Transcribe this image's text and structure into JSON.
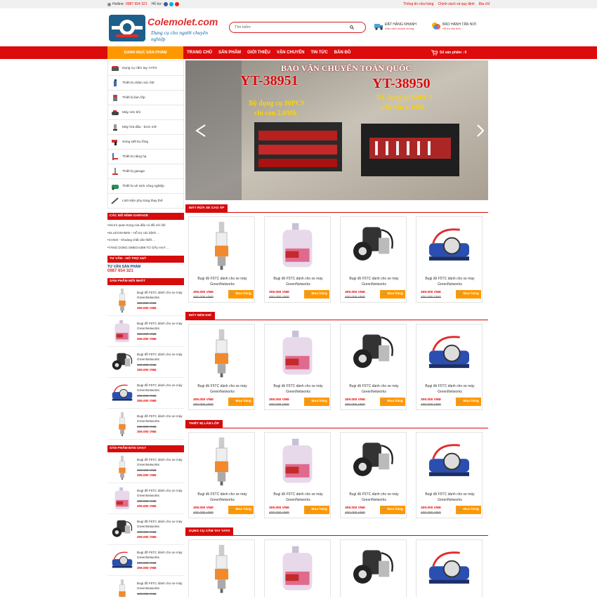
{
  "topbar": {
    "hotline_label": "Hotline:",
    "hotline": "0987 654 321",
    "support_label": "Hỗ trợ:",
    "links": [
      "Thông tin cửa hàng",
      "Chính sách và quy định",
      "Địa chỉ"
    ]
  },
  "logo": {
    "name": "Colemolet.com",
    "tagline": "Dụng cụ cho người chuyên nghiệp"
  },
  "search": {
    "placeholder": "Tìm kiếm"
  },
  "services": [
    {
      "title": "ĐẶT HÀNG NHANH",
      "sub": "Giao dịch nhanh chóng"
    },
    {
      "title": "BẢO HÀNH TẬN NƠI",
      "sub": "Hỗ trợ tận tình"
    }
  ],
  "nav": {
    "category": "DANH MỤC SẢN PHẨM",
    "items": [
      "TRANG CHỦ",
      "SẢN PHẨM",
      "GIỚI THIỆU",
      "VẬN CHUYỂN",
      "TIN TỨC",
      "BẢN ĐỒ"
    ],
    "cart": "Số sản phẩm : 0"
  },
  "categories": [
    "Dụng cụ cầm tay YATO",
    "Thiết bị chăm sóc ôtô",
    "Thiết bị làm lốp",
    "Máy nén khí",
    "Máy hút dầu - bơm mỡ",
    "Súng siết bu lông",
    "Thiết bị nâng hạ",
    "Thiết bị garage",
    "Thiết bị vệ sinh công nghiệp",
    "Linh kiện phụ tùng thay thế"
  ],
  "sidebar": {
    "garage_title": "CÁC MÔ HÌNH GARAGE",
    "news": [
      "•Vai trò quan trọng của dầu có đối với ôtô",
      "•GLUCOSAMIN – Hỗ trợ các bệnh ...",
      "•CANXI - Khoáng chất cần thiết ...",
      "•TĂNG DÙNG OMEGA369 TỪ DẦU HẠT ..."
    ],
    "support_title": "TƯ VẤN - HỖ TRỢ 24/7",
    "support_label": "TƯ VẤN SẢN PHẨM",
    "support_phone": "0987 654 321",
    "new_title": "SẢN PHẨM MỚI NHẤT",
    "hot_title": "SẢN PHẨM BÁN CHẠY",
    "item_name": "Bugi đồ F5TC dành cho xe máy GreenNetworks",
    "item_old": "400.000 VNĐ",
    "item_price": "309.000 VNĐ"
  },
  "slider": {
    "banner": "BAO VẬN CHUYỂN TOÀN QUỐC",
    "p1_code": "YT-38951",
    "p1_desc": "Bộ dụng cụ 80PCS",
    "p1_price": "chỉ còn 2.690k",
    "p2_code": "YT-38950",
    "p2_desc": "Bộ dụng cụ 64PCS",
    "p2_price": "chỉ còn 4.190k"
  },
  "sections": [
    "MÁY RỬA XE CAO ÁP",
    "MÁY NÉN KHÍ",
    "THIẾT BỊ LÀM LỐP",
    "DỤNG CỤ CẦM TAY YATO"
  ],
  "product": {
    "name": "Bugi đồ F5TC dành cho xe máy GreenNetworks",
    "price": "309.000 VNĐ",
    "old": "400.000 VNĐ",
    "buy": "Mua hàng"
  },
  "colors": {
    "red": "#dd0b0b",
    "orange": "#ff9800",
    "brand": "#e32b2b"
  }
}
